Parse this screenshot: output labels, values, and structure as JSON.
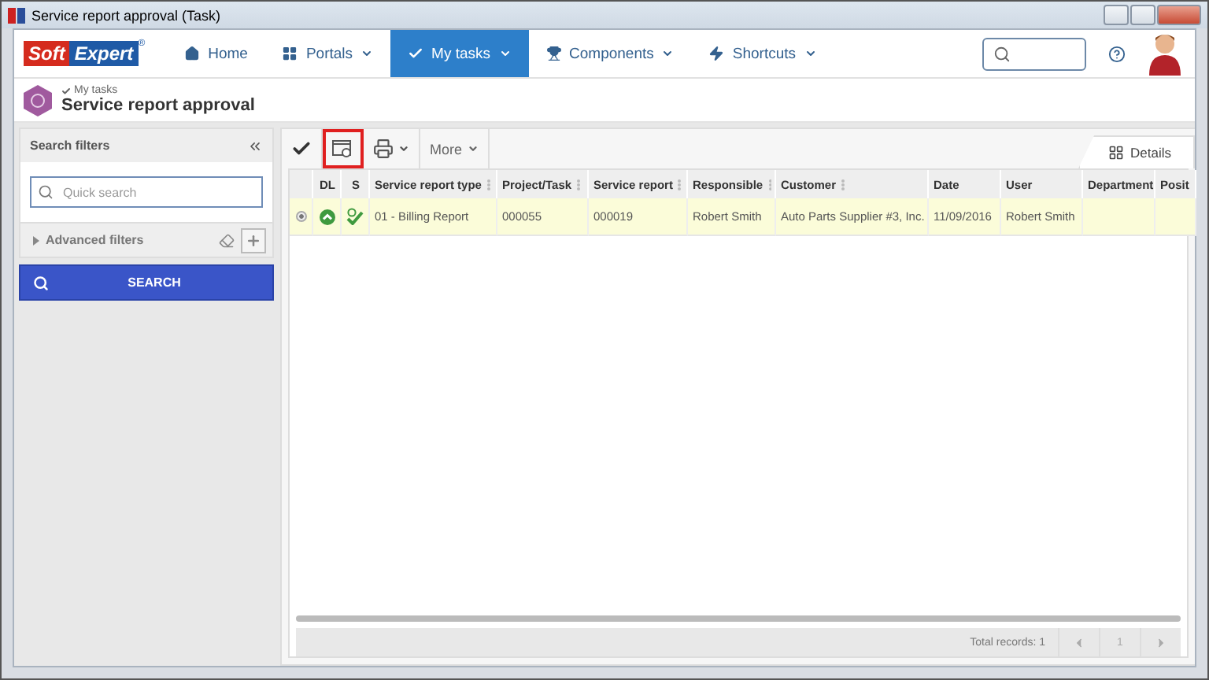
{
  "window": {
    "title": "Service report approval (Task)"
  },
  "logo": {
    "part_1": "Soft",
    "part_2": "Expert",
    "mark": "®"
  },
  "nav": [
    {
      "label": "Home",
      "dropdown": false,
      "selected": false
    },
    {
      "label": "Portals",
      "dropdown": true,
      "selected": false
    },
    {
      "label": "My tasks",
      "dropdown": true,
      "selected": true
    },
    {
      "label": "Components",
      "dropdown": true,
      "selected": false
    },
    {
      "label": "Shortcuts",
      "dropdown": true,
      "selected": false
    }
  ],
  "header": {
    "breadcrumb": "My tasks",
    "title": "Service report approval"
  },
  "filters": {
    "title": "Search filters",
    "quick_search": {
      "placeholder": "Quick search"
    },
    "advanced": "Advanced filters",
    "search_button": "SEARCH"
  },
  "toolbar": [
    {
      "kind": "check",
      "highlighted": false
    },
    {
      "kind": "view",
      "highlighted": true
    },
    {
      "kind": "print",
      "highlighted": false
    },
    {
      "kind": "more",
      "label": "More",
      "highlighted": false
    }
  ],
  "tabs": [
    {
      "label": "Details",
      "selected": true
    }
  ],
  "table": {
    "columns": [
      {
        "label": "DL",
        "sortable": false
      },
      {
        "label": "S",
        "sortable": false
      },
      {
        "label": "Service report type",
        "sortable": true
      },
      {
        "label": "Project/Task",
        "sortable": true
      },
      {
        "label": "Service report",
        "sortable": true
      },
      {
        "label": "Responsible",
        "sortable": true
      },
      {
        "label": "Customer",
        "sortable": true
      },
      {
        "label": "Date",
        "sortable": false
      },
      {
        "label": "User",
        "sortable": false
      },
      {
        "label": "Department",
        "sortable": false
      },
      {
        "label": "Posit",
        "sortable": false
      }
    ],
    "rows": [
      {
        "selected": true,
        "cells": [
          "",
          "",
          "01 - Billing Report",
          "000055",
          "000019",
          "Robert Smith",
          "Auto Parts Supplier #3, Inc.",
          "11/09/2016",
          "Robert Smith",
          "",
          ""
        ]
      }
    ]
  },
  "footer": {
    "total": "Total records: 1",
    "page": "1"
  }
}
